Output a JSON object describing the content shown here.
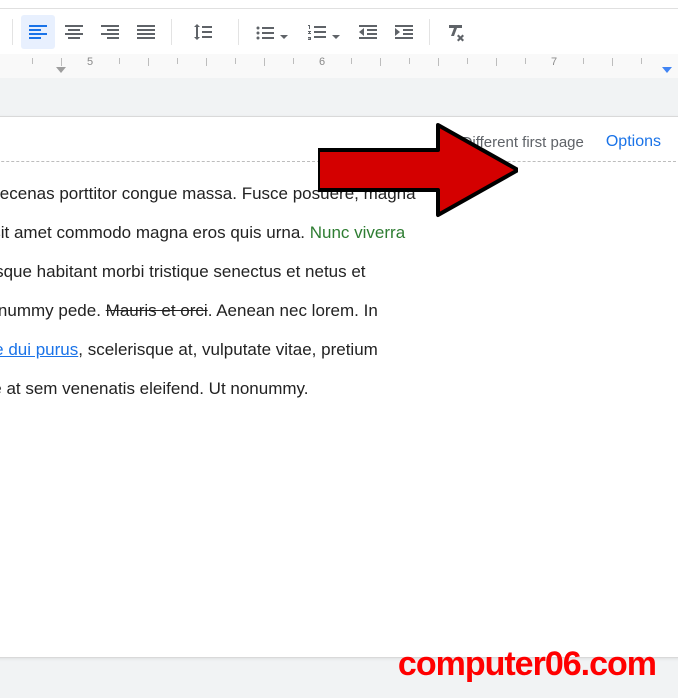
{
  "toolbar": {
    "icons": [
      "align-left-icon",
      "align-center-icon",
      "align-right-icon",
      "align-justify-icon",
      "line-spacing-icon",
      "bulleted-list-icon",
      "numbered-list-icon",
      "indent-decrease-icon",
      "indent-increase-icon",
      "clear-formatting-icon"
    ]
  },
  "ruler": {
    "numbers": [
      "5",
      "6",
      "7"
    ]
  },
  "header": {
    "checkbox_label": "Different first page",
    "options_label": "Options"
  },
  "body": {
    "line1_a": "elit. Maecenas porttitor congue massa. Fusce posuere, magna",
    "line2_a": "ibero, sit amet commodo magna eros quis urna. ",
    "line2_green": "Nunc viverra",
    "line3": "ellentesque habitant morbi tristique senectus et netus et",
    "line4_a": "etra nonummy pede. ",
    "line4_strike": "Mauris et orci",
    "line4_b": ". Aenean nec lorem. In",
    "line5_link": "endisse dui purus",
    "line5_b": ", scelerisque at, vulputate vitae, pretium",
    "line6": "t neque at sem venenatis eleifend. Ut nonummy."
  },
  "watermark": "computer06.com"
}
